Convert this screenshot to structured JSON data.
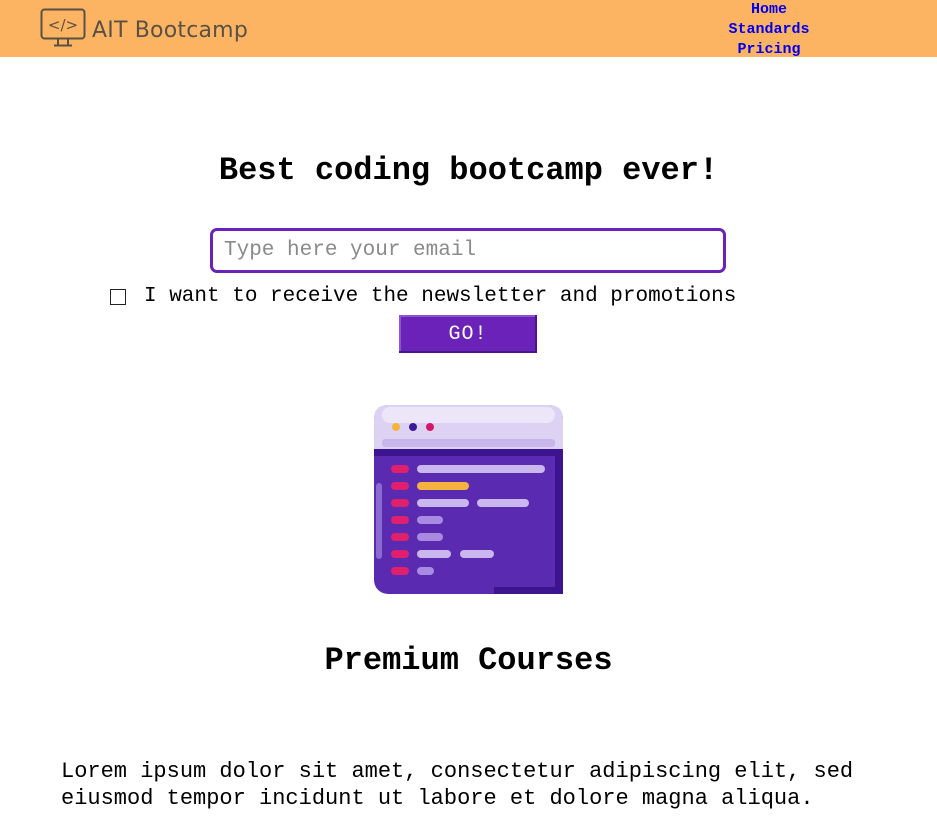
{
  "header": {
    "logo_text": "AIT Bootcamp",
    "logo_icon": "code-monitor-icon",
    "bg_color": "#fcb462",
    "nav": [
      {
        "label": "Home"
      },
      {
        "label": "Standards"
      },
      {
        "label": "Pricing"
      }
    ]
  },
  "hero": {
    "title": "Best coding bootcamp ever!",
    "email_placeholder": "Type here your email",
    "newsletter_label": "I want to receive the newsletter and promotions",
    "newsletter_checked": false,
    "submit_label": "GO!",
    "accent_color": "#6a22b8"
  },
  "illustration": {
    "icon": "code-editor-window-icon"
  },
  "courses": {
    "title": "Premium Courses",
    "text": "Lorem ipsum dolor sit amet, consectetur adipiscing elit, sed eiusmod tempor incidunt ut labore et dolore magna aliqua."
  }
}
